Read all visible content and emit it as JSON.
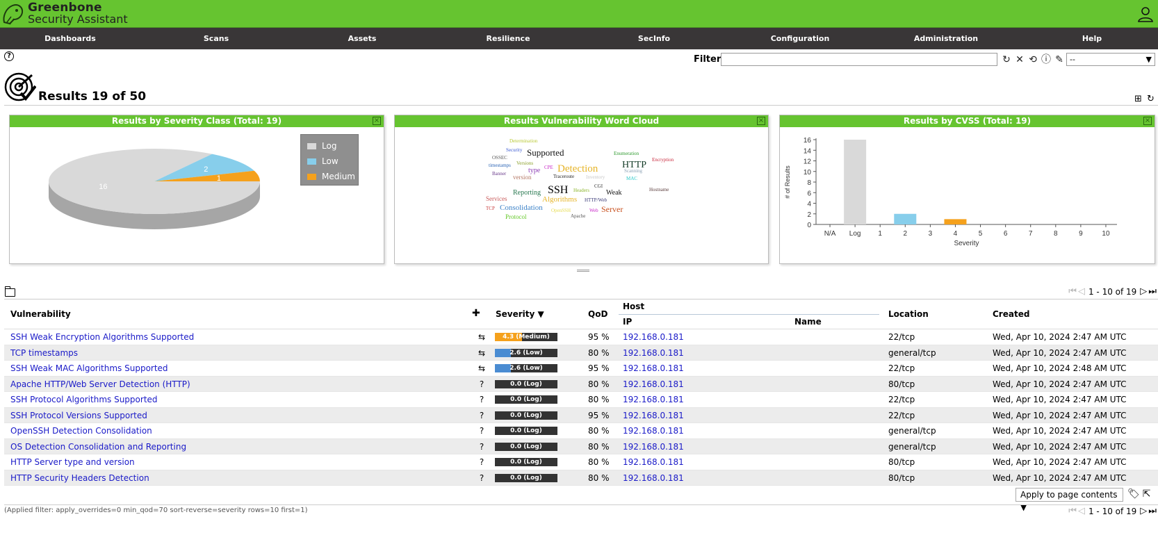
{
  "app": {
    "brand_line1": "Greenbone",
    "brand_line2": "Security Assistant",
    "accent_color": "#66c430",
    "nav_color": "#393637"
  },
  "nav": [
    {
      "label": "Dashboards"
    },
    {
      "label": "Scans"
    },
    {
      "label": "Assets"
    },
    {
      "label": "Resilience"
    },
    {
      "label": "SecInfo"
    },
    {
      "label": "Configuration"
    },
    {
      "label": "Administration"
    },
    {
      "label": "Help"
    }
  ],
  "filter": {
    "label": "Filter",
    "value": "",
    "select_value": "--",
    "icons": [
      "refresh-icon",
      "clear-filter-icon",
      "reset-filter-icon",
      "filter-help-icon",
      "edit-filter-icon"
    ]
  },
  "page": {
    "title": "Results 19 of 50",
    "help_glyph": "?"
  },
  "panels": {
    "severity_class": {
      "title": "Results by Severity Class (Total: 19)",
      "chart_data": {
        "type": "pie",
        "title": "Results by Severity Class (Total: 19)",
        "categories": [
          "Log",
          "Low",
          "Medium"
        ],
        "values": [
          16,
          2,
          1
        ],
        "colors": [
          "#d9d9d9",
          "#87ceeb",
          "#f5a11c"
        ],
        "legend_position": "top-right"
      },
      "legend": [
        {
          "label": "Log",
          "color": "#d9d9d9"
        },
        {
          "label": "Low",
          "color": "#87ceeb"
        },
        {
          "label": "Medium",
          "color": "#f5a11c"
        }
      ],
      "slice_labels": [
        "16",
        "2",
        "1"
      ]
    },
    "word_cloud": {
      "title": "Results Vulnerability Word Cloud",
      "words": [
        {
          "text": "Determination",
          "color": "#b8c832"
        },
        {
          "text": "Security",
          "color": "#3c5ad2"
        },
        {
          "text": "Supported",
          "color": "#111111"
        },
        {
          "text": "OSSEC",
          "color": "#555555"
        },
        {
          "text": "Enumeration",
          "color": "#2e9a2e"
        },
        {
          "text": "Encryption",
          "color": "#c8283c"
        },
        {
          "text": "Versions",
          "color": "#8aa028"
        },
        {
          "text": "timestamps",
          "color": "#2862b4"
        },
        {
          "text": "CPE",
          "color": "#c828c8"
        },
        {
          "text": "type",
          "color": "#8c3cb4"
        },
        {
          "text": "Detection",
          "color": "#e6b428"
        },
        {
          "text": "HTTP",
          "color": "#143c28"
        },
        {
          "text": "Banner",
          "color": "#6a3c8c"
        },
        {
          "text": "version",
          "color": "#b47864"
        },
        {
          "text": "Traceroute",
          "color": "#222222"
        },
        {
          "text": "Inventory",
          "color": "#c8c8c8"
        },
        {
          "text": "Scanning",
          "color": "#8aa0b4"
        },
        {
          "text": "MAC",
          "color": "#28c8c8"
        },
        {
          "text": "CGI",
          "color": "#333333"
        },
        {
          "text": "SSH",
          "color": "#000000"
        },
        {
          "text": "Reporting",
          "color": "#287850"
        },
        {
          "text": "Headers",
          "color": "#8ab428"
        },
        {
          "text": "Weak",
          "color": "#111111"
        },
        {
          "text": "Hostname",
          "color": "#5a3c3c"
        },
        {
          "text": "Services",
          "color": "#c85a5a"
        },
        {
          "text": "Algorithms",
          "color": "#e6b428"
        },
        {
          "text": "HTTP/Web",
          "color": "#3c3c78"
        },
        {
          "text": "TCP",
          "color": "#c83c3c"
        },
        {
          "text": "Consolidation",
          "color": "#3c82c8"
        },
        {
          "text": "OpenSSH",
          "color": "#e6dc50"
        },
        {
          "text": "Web",
          "color": "#c828c8"
        },
        {
          "text": "Server",
          "color": "#c8501e"
        },
        {
          "text": "Apache",
          "color": "#555555"
        },
        {
          "text": "Protocol",
          "color": "#64c828"
        }
      ]
    },
    "cvss": {
      "title": "Results by CVSS (Total: 19)",
      "chart_data": {
        "type": "bar",
        "title": "Results by CVSS (Total: 19)",
        "categories": [
          "N/A",
          "Log",
          "1",
          "2",
          "3",
          "4",
          "5",
          "6",
          "7",
          "8",
          "9",
          "10"
        ],
        "values": [
          0,
          16,
          0,
          2,
          0,
          1,
          0,
          0,
          0,
          0,
          0,
          0
        ],
        "bar_colors": {
          "Log": "#d9d9d9",
          "2": "#87ceeb",
          "4": "#f5a11c"
        },
        "xlabel": "Severity",
        "ylabel": "# of Results",
        "yticks": [
          "0",
          "2",
          "4",
          "6",
          "8",
          "10",
          "12",
          "14",
          "16"
        ],
        "ylim": [
          0,
          16
        ],
        "grid": false
      }
    }
  },
  "table": {
    "pager_text": "1 - 10 of 19",
    "headers": {
      "vulnerability": "Vulnerability",
      "severity": "Severity ▼",
      "qod": "QoD",
      "host": "Host",
      "ip": "IP",
      "name": "Name",
      "location": "Location",
      "created": "Created"
    },
    "rows": [
      {
        "vulnerability": "SSH Weak Encryption Algorithms Supported",
        "delta": "⇆",
        "severity": 4.3,
        "severity_label": "4.3 (Medium)",
        "severity_color": "#f5a11c",
        "qod": "95 %",
        "ip": "192.168.0.181",
        "name": "",
        "location": "22/tcp",
        "created": "Wed, Apr 10, 2024 2:47 AM UTC"
      },
      {
        "vulnerability": "TCP timestamps",
        "delta": "⇆",
        "severity": 2.6,
        "severity_label": "2.6 (Low)",
        "severity_color": "#4a8cd2",
        "qod": "80 %",
        "ip": "192.168.0.181",
        "name": "",
        "location": "general/tcp",
        "created": "Wed, Apr 10, 2024 2:47 AM UTC"
      },
      {
        "vulnerability": "SSH Weak MAC Algorithms Supported",
        "delta": "⇆",
        "severity": 2.6,
        "severity_label": "2.6 (Low)",
        "severity_color": "#4a8cd2",
        "qod": "95 %",
        "ip": "192.168.0.181",
        "name": "",
        "location": "22/tcp",
        "created": "Wed, Apr 10, 2024 2:48 AM UTC"
      },
      {
        "vulnerability": "Apache HTTP/Web Server Detection (HTTP)",
        "delta": "?",
        "severity": 0.0,
        "severity_label": "0.0 (Log)",
        "severity_color": "#333333",
        "qod": "80 %",
        "ip": "192.168.0.181",
        "name": "",
        "location": "80/tcp",
        "created": "Wed, Apr 10, 2024 2:47 AM UTC"
      },
      {
        "vulnerability": "SSH Protocol Algorithms Supported",
        "delta": "?",
        "severity": 0.0,
        "severity_label": "0.0 (Log)",
        "severity_color": "#333333",
        "qod": "80 %",
        "ip": "192.168.0.181",
        "name": "",
        "location": "22/tcp",
        "created": "Wed, Apr 10, 2024 2:47 AM UTC"
      },
      {
        "vulnerability": "SSH Protocol Versions Supported",
        "delta": "?",
        "severity": 0.0,
        "severity_label": "0.0 (Log)",
        "severity_color": "#333333",
        "qod": "95 %",
        "ip": "192.168.0.181",
        "name": "",
        "location": "22/tcp",
        "created": "Wed, Apr 10, 2024 2:47 AM UTC"
      },
      {
        "vulnerability": "OpenSSH Detection Consolidation",
        "delta": "?",
        "severity": 0.0,
        "severity_label": "0.0 (Log)",
        "severity_color": "#333333",
        "qod": "80 %",
        "ip": "192.168.0.181",
        "name": "",
        "location": "general/tcp",
        "created": "Wed, Apr 10, 2024 2:47 AM UTC"
      },
      {
        "vulnerability": "OS Detection Consolidation and Reporting",
        "delta": "?",
        "severity": 0.0,
        "severity_label": "0.0 (Log)",
        "severity_color": "#333333",
        "qod": "80 %",
        "ip": "192.168.0.181",
        "name": "",
        "location": "general/tcp",
        "created": "Wed, Apr 10, 2024 2:47 AM UTC"
      },
      {
        "vulnerability": "HTTP Server type and version",
        "delta": "?",
        "severity": 0.0,
        "severity_label": "0.0 (Log)",
        "severity_color": "#333333",
        "qod": "80 %",
        "ip": "192.168.0.181",
        "name": "",
        "location": "80/tcp",
        "created": "Wed, Apr 10, 2024 2:47 AM UTC"
      },
      {
        "vulnerability": "HTTP Security Headers Detection",
        "delta": "?",
        "severity": 0.0,
        "severity_label": "0.0 (Log)",
        "severity_color": "#333333",
        "qod": "80 %",
        "ip": "192.168.0.181",
        "name": "",
        "location": "80/tcp",
        "created": "Wed, Apr 10, 2024 2:47 AM UTC"
      }
    ],
    "apply_select": "Apply to page contents ▼",
    "applied_filter": "(Applied filter: apply_overrides=0 min_qod=70 sort-reverse=severity rows=10 first=1)"
  }
}
